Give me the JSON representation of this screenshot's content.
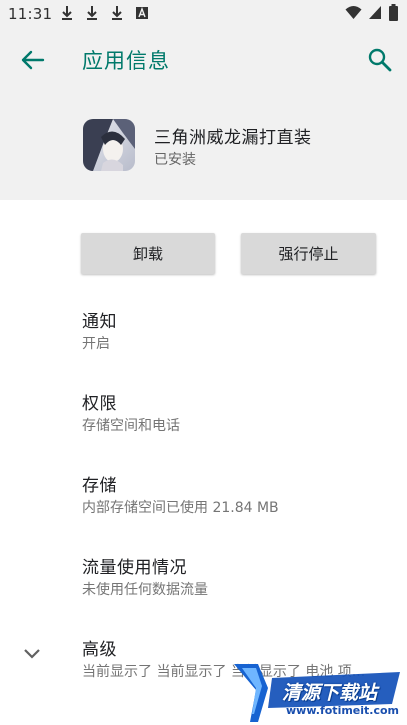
{
  "status_bar": {
    "time": "11:31",
    "left_icons": [
      "download-icon",
      "download-icon",
      "download-icon",
      "a-letter-icon"
    ],
    "right_icons": [
      "wifi-icon",
      "cellular-signal-icon",
      "battery-icon"
    ]
  },
  "app_bar": {
    "title": "应用信息",
    "back_icon": "arrow-back-icon",
    "search_icon": "search-icon",
    "accent_color": "#00796b"
  },
  "app_header": {
    "name": "三角洲威龙漏打直装",
    "status": "已安装"
  },
  "actions": {
    "uninstall_label": "卸载",
    "force_stop_label": "强行停止"
  },
  "preferences": [
    {
      "title": "通知",
      "summary": "开启"
    },
    {
      "title": "权限",
      "summary": "存储空间和电话"
    },
    {
      "title": "存储",
      "summary": "内部存储空间已使用 21.84 MB"
    },
    {
      "title": "流量使用情况",
      "summary": "未使用任何数据流量"
    },
    {
      "title": "高级",
      "summary": "当前显示了 当前显示了 当前显示了 电池 项..."
    }
  ],
  "watermark": {
    "text": "清源下载站",
    "url": "www.fotimeit.com"
  }
}
